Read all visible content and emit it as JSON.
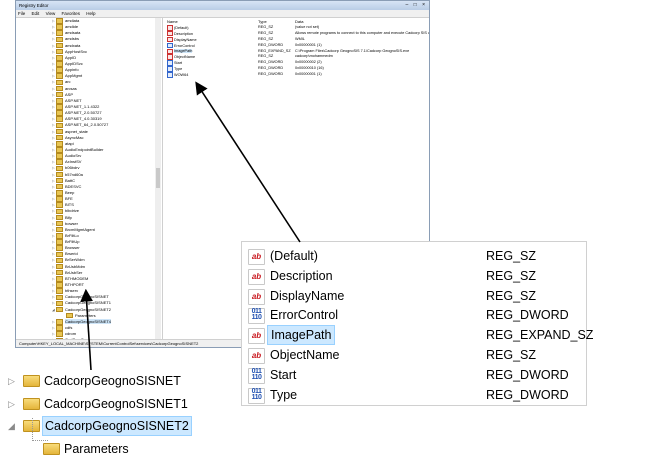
{
  "window": {
    "title": "Registry Editor",
    "controls": "–  □  ×",
    "menu": [
      "File",
      "Edit",
      "View",
      "Favorites",
      "Help"
    ],
    "status": "Computer\\HKEY_LOCAL_MACHINE\\SYSTEM\\CurrentControlSet\\services\\CadcorpGeognoSISNET2"
  },
  "tree": [
    {
      "label": "amdiata",
      "exp": "▷"
    },
    {
      "label": "amdide",
      "exp": "▷"
    },
    {
      "label": "amdsata",
      "exp": "▷"
    },
    {
      "label": "amdsbs",
      "exp": "▷"
    },
    {
      "label": "amdxata",
      "exp": "▷"
    },
    {
      "label": "AppHostSvc",
      "exp": "▷"
    },
    {
      "label": "AppID",
      "exp": "▷"
    },
    {
      "label": "AppIDSvc",
      "exp": "▷"
    },
    {
      "label": "Appinfo",
      "exp": "▷"
    },
    {
      "label": "AppMgmt",
      "exp": "▷"
    },
    {
      "label": "arc",
      "exp": "▷"
    },
    {
      "label": "arcsas",
      "exp": "▷"
    },
    {
      "label": "ASP",
      "exp": "▷"
    },
    {
      "label": "ASP.NET",
      "exp": "▷"
    },
    {
      "label": "ASP.NET_1.1.4322",
      "exp": "▷"
    },
    {
      "label": "ASP.NET_2.0.50727",
      "exp": "▷"
    },
    {
      "label": "ASP.NET_4.0.30319",
      "exp": "▷"
    },
    {
      "label": "ASP.NET_64_2.0.50727",
      "exp": "▷"
    },
    {
      "label": "aspnet_state",
      "exp": "▷"
    },
    {
      "label": "AsyncMac",
      "exp": "▷"
    },
    {
      "label": "atapi",
      "exp": "▷"
    },
    {
      "label": "AudioEndpointBuilder",
      "exp": "▷"
    },
    {
      "label": "AudioSrv",
      "exp": "▷"
    },
    {
      "label": "AxInstSV",
      "exp": "▷"
    },
    {
      "label": "b06bdrv",
      "exp": "▷"
    },
    {
      "label": "b57nd60a",
      "exp": "▷"
    },
    {
      "label": "BattC",
      "exp": "▷"
    },
    {
      "label": "BDESVC",
      "exp": "▷"
    },
    {
      "label": "Beep",
      "exp": "▷"
    },
    {
      "label": "BFE",
      "exp": "▷"
    },
    {
      "label": "BITS",
      "exp": "▷"
    },
    {
      "label": "blbdrive",
      "exp": "▷"
    },
    {
      "label": "Blfp",
      "exp": "▷"
    },
    {
      "label": "bowser",
      "exp": "▷"
    },
    {
      "label": "BrcmMgmtAgent",
      "exp": "▷"
    },
    {
      "label": "BrFiltLo",
      "exp": "▷"
    },
    {
      "label": "BrFiltUp",
      "exp": "▷"
    },
    {
      "label": "Browser",
      "exp": "▷"
    },
    {
      "label": "Brserid",
      "exp": "▷"
    },
    {
      "label": "BrSerWdm",
      "exp": "▷"
    },
    {
      "label": "BrUsbMdm",
      "exp": "▷"
    },
    {
      "label": "BrUsbSer",
      "exp": "▷"
    },
    {
      "label": "BTHMODEM",
      "exp": "▷"
    },
    {
      "label": "BTHPORT",
      "exp": "▷"
    },
    {
      "label": "bthserv",
      "exp": "▷"
    },
    {
      "label": "CadcorpGeognoSISNET",
      "exp": "▷"
    },
    {
      "label": "CadcorpGeognoSISNET1",
      "exp": "▷"
    },
    {
      "label": "CadcorpGeognoSISNET2",
      "exp": "◢"
    },
    {
      "label": "Parameters",
      "exp": "",
      "sub": true
    },
    {
      "label": "CadcorpGeognoSISNET4",
      "exp": "▷",
      "sel": true
    },
    {
      "label": "cdfs",
      "exp": "▷"
    },
    {
      "label": "cdrom",
      "exp": "▷"
    },
    {
      "label": "CertPropSvc",
      "exp": "▷"
    },
    {
      "label": "circlass",
      "exp": "▷"
    },
    {
      "label": "CLFS",
      "exp": "▷"
    },
    {
      "label": "clr_optimization_v2.0.50727_32",
      "exp": "▷"
    },
    {
      "label": "clr_optimization_v2.0.50727_64",
      "exp": "▷"
    }
  ],
  "values_small": {
    "headers": [
      "Name",
      "Type",
      "Data"
    ],
    "rows": [
      {
        "name": "(Default)",
        "type": "REG_SZ",
        "data": "(value not set)",
        "icon": "ab"
      },
      {
        "name": "Description",
        "type": "REG_SZ",
        "data": "Allows remote programs to connect to this computer and execute Cadcorp SIS commands using SOAP.",
        "icon": "ab"
      },
      {
        "name": "DisplayName",
        "type": "REG_SZ",
        "data": "WMIL",
        "icon": "ab"
      },
      {
        "name": "ErrorControl",
        "type": "REG_DWORD",
        "data": "0x00000001 (1)",
        "icon": "dw"
      },
      {
        "name": "ImagePath",
        "type": "REG_EXPAND_SZ",
        "data": "C:\\Program Files\\Cadcorp GeognoSIS 7.1\\Cadcorp GeognoSIS.exe",
        "icon": "ab",
        "sel": true
      },
      {
        "name": "ObjectName",
        "type": "REG_SZ",
        "data": "cadcorp\\mohammedm",
        "icon": "ab"
      },
      {
        "name": "Start",
        "type": "REG_DWORD",
        "data": "0x00000002 (2)",
        "icon": "dw"
      },
      {
        "name": "Type",
        "type": "REG_DWORD",
        "data": "0x00000010 (16)",
        "icon": "dw"
      },
      {
        "name": "WOW64",
        "type": "REG_DWORD",
        "data": "0x00000001 (1)",
        "icon": "dw"
      }
    ]
  },
  "values_zoom": [
    {
      "name": "(Default)",
      "type": "REG_SZ",
      "icon": "ab"
    },
    {
      "name": "Description",
      "type": "REG_SZ",
      "icon": "ab"
    },
    {
      "name": "DisplayName",
      "type": "REG_SZ",
      "icon": "ab"
    },
    {
      "name": "ErrorControl",
      "type": "REG_DWORD",
      "icon": "dw"
    },
    {
      "name": "ImagePath",
      "type": "REG_EXPAND_SZ",
      "icon": "ab",
      "sel": true
    },
    {
      "name": "ObjectName",
      "type": "REG_SZ",
      "icon": "ab"
    },
    {
      "name": "Start",
      "type": "REG_DWORD",
      "icon": "dw"
    },
    {
      "name": "Type",
      "type": "REG_DWORD",
      "icon": "dw"
    }
  ],
  "icons": {
    "ab": "ab",
    "dw": "011\n110"
  },
  "tree_zoom": [
    {
      "label": "CadcorpGeognoSISNET",
      "arrow": "▷"
    },
    {
      "label": "CadcorpGeognoSISNET1",
      "arrow": "▷"
    },
    {
      "label": "CadcorpGeognoSISNET2",
      "arrow": "◢",
      "sel": true
    },
    {
      "label": "Parameters",
      "arrow": "",
      "sub": true
    }
  ]
}
